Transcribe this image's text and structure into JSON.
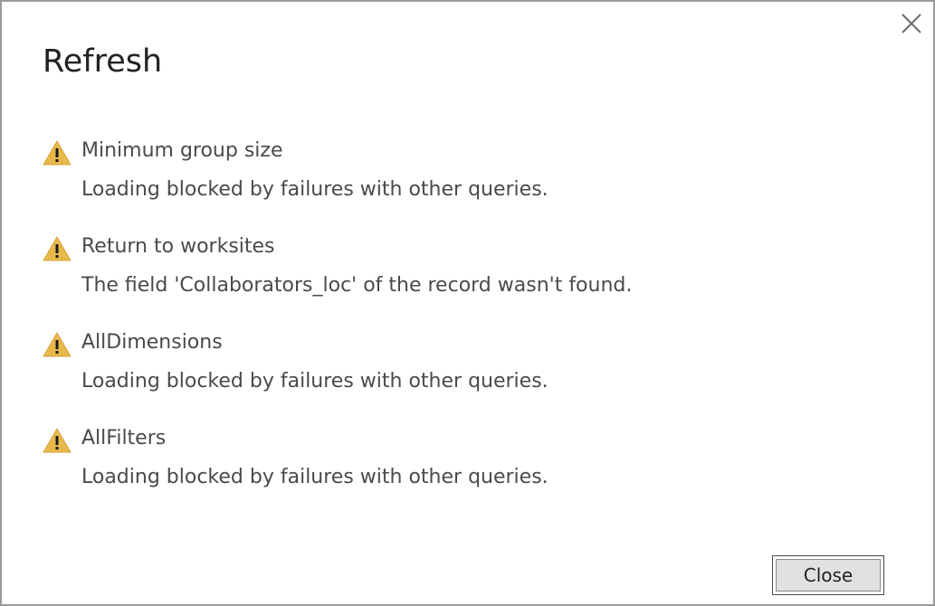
{
  "dialog": {
    "title": "Refresh",
    "close_icon": "close-icon",
    "close_button_label": "Close",
    "warning_color": "#e8b84a"
  },
  "messages": [
    {
      "icon": "warning-icon",
      "title": "Minimum group size",
      "detail": "Loading blocked by failures with other queries."
    },
    {
      "icon": "warning-icon",
      "title": "Return to worksites",
      "detail": "The field 'Collaborators_loc' of the record wasn't found."
    },
    {
      "icon": "warning-icon",
      "title": "AllDimensions",
      "detail": "Loading blocked by failures with other queries."
    },
    {
      "icon": "warning-icon",
      "title": "AllFilters",
      "detail": "Loading blocked by failures with other queries."
    }
  ]
}
